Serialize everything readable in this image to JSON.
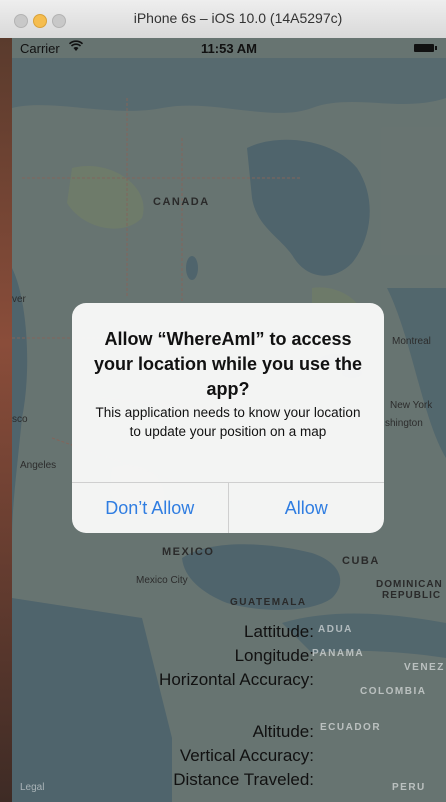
{
  "window": {
    "title": "iPhone 6s – iOS 10.0 (14A5297c)"
  },
  "status_bar": {
    "carrier": "Carrier",
    "time": "11:53 AM"
  },
  "map": {
    "country_labels": [
      "CANADA",
      "MEXICO",
      "CUBA",
      "GUATEMALA"
    ],
    "dominican_label_1": "DOMINICAN",
    "dominican_label_2": "REPUBLIC",
    "city_labels": [
      "Montreal",
      "New York",
      "shington",
      "sco",
      "Angeles",
      "Mexico City",
      "ver"
    ],
    "faint_labels": [
      "ADUA",
      "PANAMA",
      "VENEZ",
      "COLOMBIA",
      "ECUADOR",
      "PERU"
    ],
    "legal": "Legal"
  },
  "info": {
    "latitude_label": "Lattitude:",
    "longitude_label": "Longitude:",
    "horizontal_accuracy_label": "Horizontal Accuracy:",
    "altitude_label": "Altitude:",
    "vertical_accuracy_label": "Vertical Accuracy:",
    "distance_traveled_label": "Distance Traveled:"
  },
  "alert": {
    "title": "Allow “WhereAmI” to access your location while you use the app?",
    "message": "This application needs to know your location to update your position on a map",
    "dont_allow_label": "Don’t Allow",
    "allow_label": "Allow"
  },
  "colors": {
    "accent": "#2f7de1",
    "alert_bg": "#f8f8f8"
  }
}
